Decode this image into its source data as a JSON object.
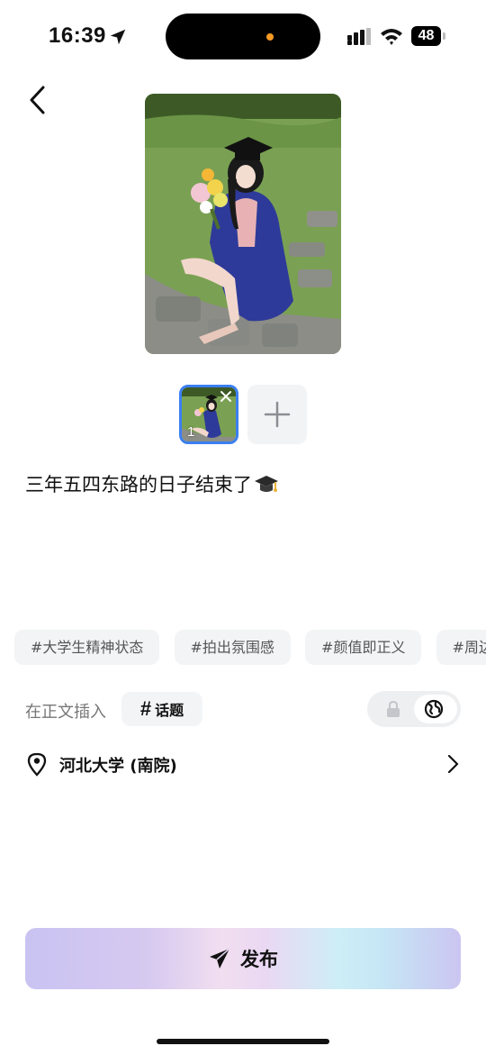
{
  "status_bar": {
    "time": "16:39",
    "battery": "48"
  },
  "photo": {
    "thumbnail_index": "1"
  },
  "caption": {
    "text": "三年五四东路的日子结束了"
  },
  "topics": [
    "#大学生精神状态",
    "#拍出氛围感",
    "#颜值即正义",
    "#周边遛"
  ],
  "insert": {
    "label": "在正文插入",
    "hash": "#",
    "topic_label": "话题"
  },
  "location": {
    "name": "河北大学 (南院)"
  },
  "publish": {
    "label": "发布"
  },
  "colors": {
    "accent_blue": "#3b7ff2",
    "chip_bg": "#f3f4f6",
    "text": "#111111"
  }
}
